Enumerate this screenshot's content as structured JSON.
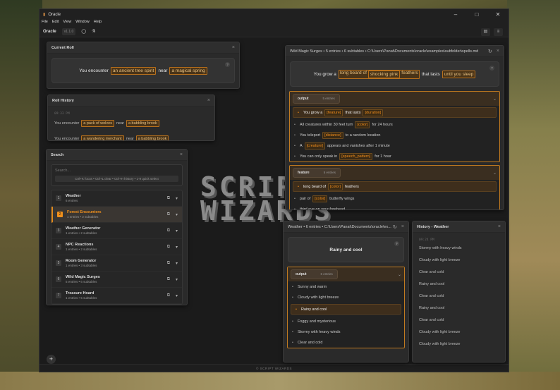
{
  "app": {
    "title": "Oracle",
    "menu": [
      "File",
      "Edit",
      "View",
      "Window",
      "Help"
    ],
    "name": "Oracle",
    "version": "v1.1.0",
    "footer": "© SCRIPT WIZARDS",
    "logo": "SCRIPT WIZARDS"
  },
  "current_roll": {
    "title": "Current Roll",
    "parts": [
      "You encounter",
      "an ancient tree spirit",
      "near",
      "a magical spring"
    ]
  },
  "roll_history": {
    "title": "Roll History",
    "timestamp": "09:33 PM",
    "rows": [
      [
        "You encounter",
        "a pack of wolves",
        "near",
        "a babbling brook"
      ],
      [
        "You encounter",
        "a wandering merchant",
        "near",
        "a babbling brook"
      ]
    ]
  },
  "search": {
    "title": "Search",
    "placeholder": "Search...",
    "hint": "Ctrl+K focus • Ctrl+L clear • Ctrl+H history • 1-9 quick select",
    "items": [
      {
        "n": "1",
        "name": "Weather",
        "sub": "6 entries"
      },
      {
        "n": "2",
        "name": "Forest Encounters",
        "sub": "1 entries • 2 subtables"
      },
      {
        "n": "3",
        "name": "Weather Generator",
        "sub": "1 entries • 2 subtables"
      },
      {
        "n": "4",
        "name": "NPC Reactions",
        "sub": "1 entries • 2 subtables"
      },
      {
        "n": "5",
        "name": "Room Generator",
        "sub": "1 entries • 3 subtables"
      },
      {
        "n": "6",
        "name": "Wild Magic Surges",
        "sub": "5 entries • 6 subtables"
      },
      {
        "n": "7",
        "name": "Treasure Hoard",
        "sub": "1 entries • 5 subtables"
      }
    ]
  },
  "wild": {
    "title": "Wild Magic Surges • 5 entries • 6 subtables • C:\\Users\\Panat\\Documents\\oracle\\examples\\subfolder\\spells.md",
    "result": [
      "You grow a",
      "long beard of",
      "shocking pink",
      "feathers",
      "that lasts",
      "until you sleep"
    ],
    "output": {
      "name": "output",
      "count": "5 entries",
      "entries": [
        [
          "You grow a",
          "[feature]",
          "that lasts",
          "[duration]"
        ],
        [
          "All creatures within 30 feet turn",
          "[color]",
          "for 24 hours"
        ],
        [
          "You teleport",
          "[distance]",
          "to a random location"
        ],
        [
          "A",
          "[creature]",
          "appears and vanishes after 1 minute"
        ],
        [
          "You can only speak in",
          "[speech_pattern]",
          "for 1 hour"
        ]
      ]
    },
    "feature": {
      "name": "feature",
      "count": "5 entries",
      "entries": [
        [
          "long beard of",
          "[color]",
          "feathers"
        ],
        [
          "pair of",
          "[color]",
          "butterfly wings"
        ],
        [
          "third eye on your forehead"
        ]
      ]
    }
  },
  "weather": {
    "title": "Weather • 6 entries • C:\\Users\\Panat\\Documents\\oracle\\ex...",
    "result": "Rainy and cool",
    "output": {
      "name": "output",
      "count": "6 entries",
      "entries": [
        "Sunny and warm",
        "Cloudy with light breeze",
        "Rainy and cool",
        "Foggy and mysterious",
        "Stormy with heavy winds",
        "Clear and cold"
      ]
    }
  },
  "history_weather": {
    "title": "History - Weather",
    "timestamp": "09:24 PM",
    "rows": [
      "Stormy with heavy winds",
      "Cloudy with light breeze",
      "Clear and cold",
      "Rainy and cool",
      "Clear and cold",
      "Rainy and cool",
      "Clear and cold",
      "Cloudy with light breeze",
      "Cloudy with light breeze"
    ]
  }
}
